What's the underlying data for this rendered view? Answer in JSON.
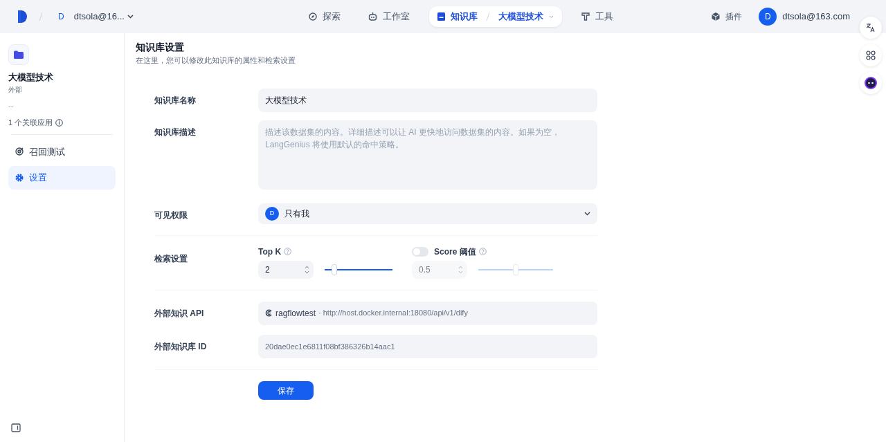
{
  "topbar": {
    "workspace_initial": "D",
    "workspace": "dtsola@16...",
    "nav": [
      {
        "label": "探索",
        "selected": false
      },
      {
        "label": "工作室",
        "selected": false
      },
      {
        "label": "知识库",
        "selected": true,
        "detail": "大模型技术"
      },
      {
        "label": "工具",
        "selected": false
      }
    ],
    "plugins": "插件",
    "user": {
      "initial": "D",
      "email": "dtsola@163.com"
    }
  },
  "sidebar": {
    "name": "大模型技术",
    "type": "外部",
    "description": "--",
    "linked_apps": "1 个关联应用",
    "items": [
      {
        "label": "召回测试",
        "selected": false
      },
      {
        "label": "设置",
        "selected": true
      }
    ]
  },
  "page": {
    "title": "知识库设置",
    "subtitle": "在这里，您可以修改此知识库的属性和检索设置"
  },
  "form": {
    "name": {
      "label": "知识库名称",
      "value": "大模型技术"
    },
    "description": {
      "label": "知识库描述",
      "placeholder": "描述该数据集的内容。详细描述可以让 AI 更快地访问数据集的内容。如果为空，LangGenius 将使用默认的命中策略。"
    },
    "permission": {
      "label": "可见权限",
      "avatar_initial": "D",
      "value": "只有我"
    },
    "retrieval": {
      "label": "检索设置",
      "top_k": {
        "label": "Top K",
        "value": "2",
        "level": 0.14
      },
      "score": {
        "label": "Score 阈值",
        "enabled": false,
        "value": "0.5",
        "level": 0.5
      }
    },
    "api": {
      "label": "外部知识 API",
      "name": "ragflowtest",
      "url": "· http://host.docker.internal:18080/api/v1/dify"
    },
    "kb_id": {
      "label": "外部知识库 ID",
      "value": "20dae0ec1e6811f08bf386326b14aac1"
    },
    "save": "保存"
  }
}
